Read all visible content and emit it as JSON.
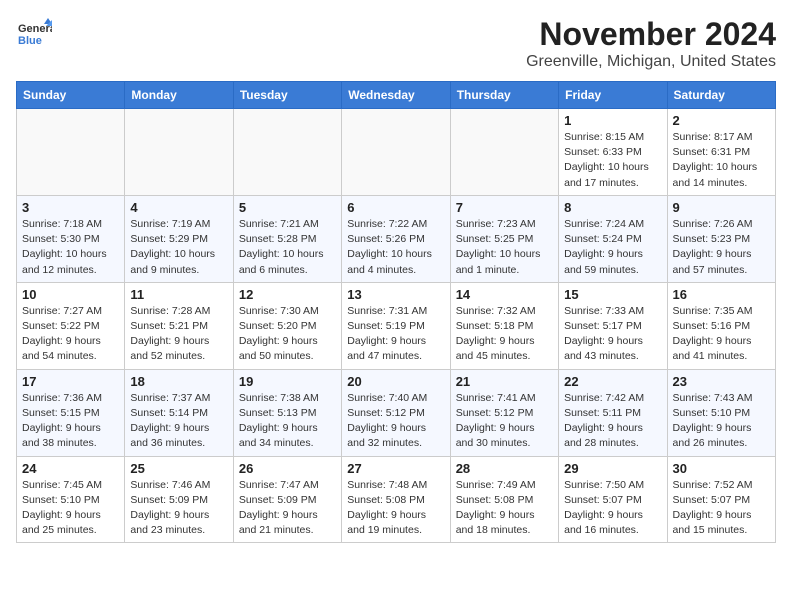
{
  "header": {
    "logo_line1": "General",
    "logo_line2": "Blue",
    "month": "November 2024",
    "location": "Greenville, Michigan, United States"
  },
  "days_of_week": [
    "Sunday",
    "Monday",
    "Tuesday",
    "Wednesday",
    "Thursday",
    "Friday",
    "Saturday"
  ],
  "weeks": [
    [
      {
        "day": "",
        "info": ""
      },
      {
        "day": "",
        "info": ""
      },
      {
        "day": "",
        "info": ""
      },
      {
        "day": "",
        "info": ""
      },
      {
        "day": "",
        "info": ""
      },
      {
        "day": "1",
        "info": "Sunrise: 8:15 AM\nSunset: 6:33 PM\nDaylight: 10 hours and 17 minutes."
      },
      {
        "day": "2",
        "info": "Sunrise: 8:17 AM\nSunset: 6:31 PM\nDaylight: 10 hours and 14 minutes."
      }
    ],
    [
      {
        "day": "3",
        "info": "Sunrise: 7:18 AM\nSunset: 5:30 PM\nDaylight: 10 hours and 12 minutes."
      },
      {
        "day": "4",
        "info": "Sunrise: 7:19 AM\nSunset: 5:29 PM\nDaylight: 10 hours and 9 minutes."
      },
      {
        "day": "5",
        "info": "Sunrise: 7:21 AM\nSunset: 5:28 PM\nDaylight: 10 hours and 6 minutes."
      },
      {
        "day": "6",
        "info": "Sunrise: 7:22 AM\nSunset: 5:26 PM\nDaylight: 10 hours and 4 minutes."
      },
      {
        "day": "7",
        "info": "Sunrise: 7:23 AM\nSunset: 5:25 PM\nDaylight: 10 hours and 1 minute."
      },
      {
        "day": "8",
        "info": "Sunrise: 7:24 AM\nSunset: 5:24 PM\nDaylight: 9 hours and 59 minutes."
      },
      {
        "day": "9",
        "info": "Sunrise: 7:26 AM\nSunset: 5:23 PM\nDaylight: 9 hours and 57 minutes."
      }
    ],
    [
      {
        "day": "10",
        "info": "Sunrise: 7:27 AM\nSunset: 5:22 PM\nDaylight: 9 hours and 54 minutes."
      },
      {
        "day": "11",
        "info": "Sunrise: 7:28 AM\nSunset: 5:21 PM\nDaylight: 9 hours and 52 minutes."
      },
      {
        "day": "12",
        "info": "Sunrise: 7:30 AM\nSunset: 5:20 PM\nDaylight: 9 hours and 50 minutes."
      },
      {
        "day": "13",
        "info": "Sunrise: 7:31 AM\nSunset: 5:19 PM\nDaylight: 9 hours and 47 minutes."
      },
      {
        "day": "14",
        "info": "Sunrise: 7:32 AM\nSunset: 5:18 PM\nDaylight: 9 hours and 45 minutes."
      },
      {
        "day": "15",
        "info": "Sunrise: 7:33 AM\nSunset: 5:17 PM\nDaylight: 9 hours and 43 minutes."
      },
      {
        "day": "16",
        "info": "Sunrise: 7:35 AM\nSunset: 5:16 PM\nDaylight: 9 hours and 41 minutes."
      }
    ],
    [
      {
        "day": "17",
        "info": "Sunrise: 7:36 AM\nSunset: 5:15 PM\nDaylight: 9 hours and 38 minutes."
      },
      {
        "day": "18",
        "info": "Sunrise: 7:37 AM\nSunset: 5:14 PM\nDaylight: 9 hours and 36 minutes."
      },
      {
        "day": "19",
        "info": "Sunrise: 7:38 AM\nSunset: 5:13 PM\nDaylight: 9 hours and 34 minutes."
      },
      {
        "day": "20",
        "info": "Sunrise: 7:40 AM\nSunset: 5:12 PM\nDaylight: 9 hours and 32 minutes."
      },
      {
        "day": "21",
        "info": "Sunrise: 7:41 AM\nSunset: 5:12 PM\nDaylight: 9 hours and 30 minutes."
      },
      {
        "day": "22",
        "info": "Sunrise: 7:42 AM\nSunset: 5:11 PM\nDaylight: 9 hours and 28 minutes."
      },
      {
        "day": "23",
        "info": "Sunrise: 7:43 AM\nSunset: 5:10 PM\nDaylight: 9 hours and 26 minutes."
      }
    ],
    [
      {
        "day": "24",
        "info": "Sunrise: 7:45 AM\nSunset: 5:10 PM\nDaylight: 9 hours and 25 minutes."
      },
      {
        "day": "25",
        "info": "Sunrise: 7:46 AM\nSunset: 5:09 PM\nDaylight: 9 hours and 23 minutes."
      },
      {
        "day": "26",
        "info": "Sunrise: 7:47 AM\nSunset: 5:09 PM\nDaylight: 9 hours and 21 minutes."
      },
      {
        "day": "27",
        "info": "Sunrise: 7:48 AM\nSunset: 5:08 PM\nDaylight: 9 hours and 19 minutes."
      },
      {
        "day": "28",
        "info": "Sunrise: 7:49 AM\nSunset: 5:08 PM\nDaylight: 9 hours and 18 minutes."
      },
      {
        "day": "29",
        "info": "Sunrise: 7:50 AM\nSunset: 5:07 PM\nDaylight: 9 hours and 16 minutes."
      },
      {
        "day": "30",
        "info": "Sunrise: 7:52 AM\nSunset: 5:07 PM\nDaylight: 9 hours and 15 minutes."
      }
    ]
  ]
}
